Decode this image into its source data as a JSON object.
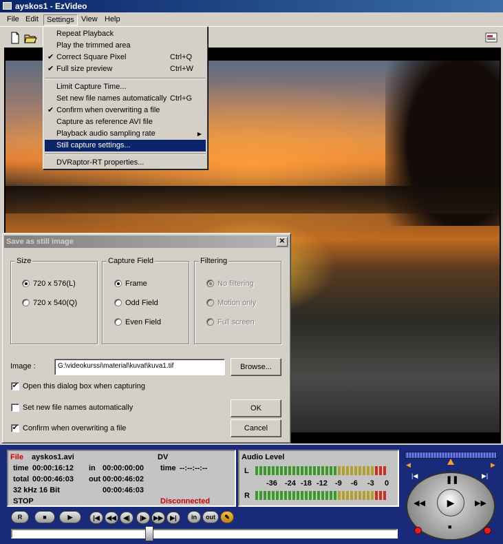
{
  "window": {
    "title": "ayskos1 - EzVideo"
  },
  "menubar": {
    "items": [
      "File",
      "Edit",
      "Settings",
      "View",
      "Help"
    ]
  },
  "settings_menu": {
    "items": [
      {
        "label": "Repeat Playback",
        "checked": false,
        "shortcut": ""
      },
      {
        "label": "Play the trimmed area",
        "checked": false,
        "shortcut": ""
      },
      {
        "label": "Correct Square Pixel",
        "checked": true,
        "shortcut": "Ctrl+Q"
      },
      {
        "label": "Full size preview",
        "checked": true,
        "shortcut": "Ctrl+W"
      },
      {
        "label": "Limit Capture Time...",
        "checked": false,
        "shortcut": ""
      },
      {
        "label": "Set new file names automatically",
        "checked": false,
        "shortcut": "Ctrl+G"
      },
      {
        "label": "Confirm when overwriting a file",
        "checked": true,
        "shortcut": ""
      },
      {
        "label": "Capture as reference AVI file",
        "checked": false,
        "shortcut": ""
      },
      {
        "label": "Playback audio sampling rate",
        "checked": false,
        "shortcut": "",
        "submenu": true
      },
      {
        "label": "Still capture settings...",
        "checked": false,
        "shortcut": "",
        "highlighted": true
      },
      {
        "label": "DVRaptor-RT properties...",
        "checked": false,
        "shortcut": ""
      }
    ]
  },
  "dialog": {
    "title": "Save as still image",
    "size": {
      "title": "Size",
      "options": [
        "720 x 576(L)",
        "720 x 540(Q)"
      ],
      "selected": 0
    },
    "capture_field": {
      "title": "Capture Field",
      "options": [
        "Frame",
        "Odd Field",
        "Even Field"
      ],
      "selected": 0
    },
    "filtering": {
      "title": "Filtering",
      "options": [
        "No filtering",
        "Motion only",
        "Full screen"
      ],
      "selected": 0,
      "disabled": true
    },
    "image_label": "Image :",
    "image_path": "G:\\videokurssi\\material\\kuvat\\kuva1.tif",
    "browse_label": "Browse...",
    "open_dialog_label": "Open this dialog box when capturing",
    "open_dialog_checked": true,
    "set_names_label": "Set new file names automatically",
    "set_names_checked": false,
    "confirm_label": "Confirm when overwriting a file",
    "confirm_checked": true,
    "ok_label": "OK",
    "cancel_label": "Cancel"
  },
  "status_panel": {
    "file_label": "File",
    "file_name": "ayskos1.avi",
    "format": "DV",
    "time_label": "time",
    "time_value": "00:00:16:12",
    "in_label": "in",
    "in_value": "00:00:00:00",
    "time2_label": "time",
    "time2_value": "--:--:--:--",
    "total_label": "total",
    "total_value": "00:00:46:03",
    "out_label": "out",
    "out_value": "00:00:46:02",
    "audio_format": "32 kHz 16 Bit",
    "duration_value": "00:00:46:03",
    "state": "STOP",
    "connection": "Disconnected"
  },
  "audio_panel": {
    "title": "Audio Level",
    "left_label": "L",
    "right_label": "R",
    "scale": [
      "-36",
      "-24",
      "-18",
      "-12",
      "-9",
      "-6",
      "-3",
      "0"
    ]
  },
  "transport": {
    "record_label": "R",
    "in_label": "in",
    "out_label": "out"
  },
  "colors": {
    "title_gradient_start": "#0a246a",
    "panel_blue": "#1a2a7a",
    "file_label_red": "#cc0000",
    "disconnected_red": "#cc0000",
    "meter_green": "#3a9a2a",
    "meter_red": "#c83020"
  }
}
